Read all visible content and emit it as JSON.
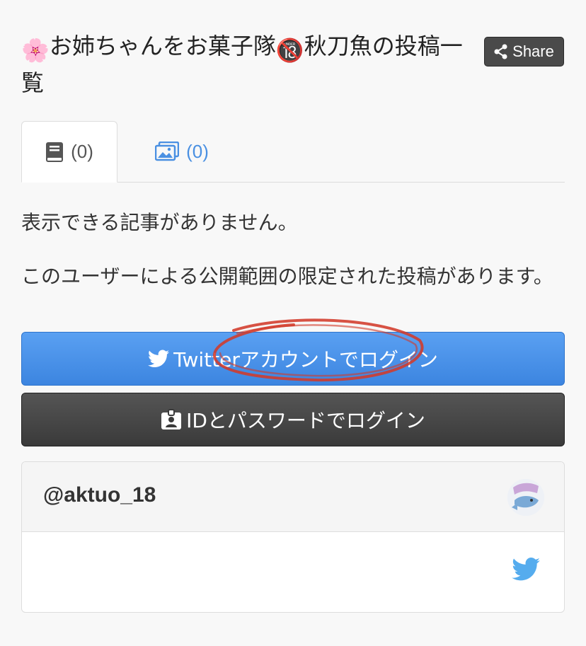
{
  "page": {
    "title_emoji_1": "🌸",
    "title_text_1": "お姉ちゃんをお菓子隊",
    "title_emoji_2": "🔞",
    "title_text_2": "秋刀魚の投稿一覧"
  },
  "share": {
    "label": "Share"
  },
  "tabs": [
    {
      "icon": "book-icon",
      "count": "(0)"
    },
    {
      "icon": "image-icon",
      "count": "(0)"
    }
  ],
  "messages": {
    "no_articles": "表示できる記事がありません。",
    "limited_posts": "このユーザーによる公開範囲の限定された投稿があります。"
  },
  "buttons": {
    "twitter_login": "Twitterアカウントでログイン",
    "id_login": "IDとパスワードでログイン"
  },
  "user_card": {
    "handle": "@aktuo_18"
  },
  "colors": {
    "accent_blue": "#4a90e2",
    "twitter_blue": "#55acee",
    "dark_button": "#444444",
    "annotation_red": "#d23a2a"
  }
}
